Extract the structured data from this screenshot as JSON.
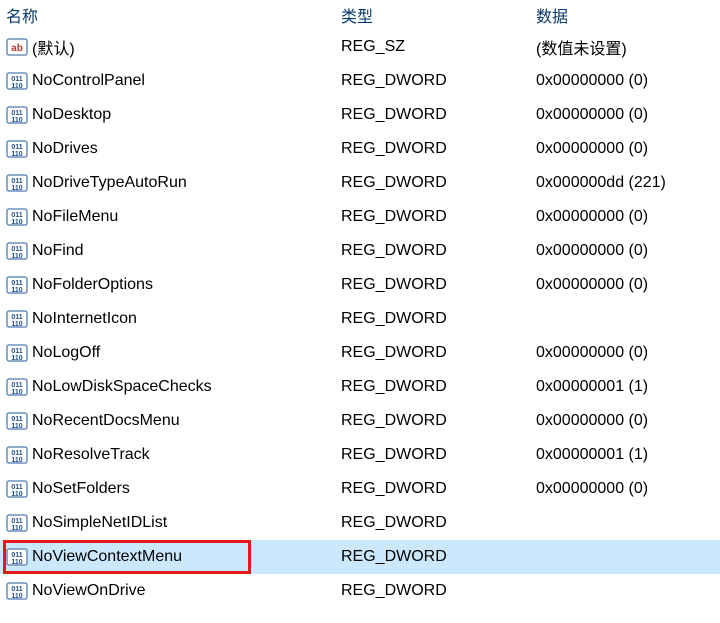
{
  "columns": {
    "name": "名称",
    "type": "类型",
    "data": "数据"
  },
  "rows": [
    {
      "icon": "string",
      "name": "(默认)",
      "type": "REG_SZ",
      "data": "(数值未设置)",
      "selected": false,
      "highlighted": false
    },
    {
      "icon": "dword",
      "name": "NoControlPanel",
      "type": "REG_DWORD",
      "data": "0x00000000 (0)",
      "selected": false,
      "highlighted": false
    },
    {
      "icon": "dword",
      "name": "NoDesktop",
      "type": "REG_DWORD",
      "data": "0x00000000 (0)",
      "selected": false,
      "highlighted": false
    },
    {
      "icon": "dword",
      "name": "NoDrives",
      "type": "REG_DWORD",
      "data": "0x00000000 (0)",
      "selected": false,
      "highlighted": false
    },
    {
      "icon": "dword",
      "name": "NoDriveTypeAutoRun",
      "type": "REG_DWORD",
      "data": "0x000000dd (221)",
      "selected": false,
      "highlighted": false
    },
    {
      "icon": "dword",
      "name": "NoFileMenu",
      "type": "REG_DWORD",
      "data": "0x00000000 (0)",
      "selected": false,
      "highlighted": false
    },
    {
      "icon": "dword",
      "name": "NoFind",
      "type": "REG_DWORD",
      "data": "0x00000000 (0)",
      "selected": false,
      "highlighted": false
    },
    {
      "icon": "dword",
      "name": "NoFolderOptions",
      "type": "REG_DWORD",
      "data": "0x00000000 (0)",
      "selected": false,
      "highlighted": false
    },
    {
      "icon": "dword",
      "name": "NoInternetIcon",
      "type": "REG_DWORD",
      "data": "",
      "selected": false,
      "highlighted": false
    },
    {
      "icon": "dword",
      "name": "NoLogOff",
      "type": "REG_DWORD",
      "data": "0x00000000 (0)",
      "selected": false,
      "highlighted": false
    },
    {
      "icon": "dword",
      "name": "NoLowDiskSpaceChecks",
      "type": "REG_DWORD",
      "data": "0x00000001 (1)",
      "selected": false,
      "highlighted": false
    },
    {
      "icon": "dword",
      "name": "NoRecentDocsMenu",
      "type": "REG_DWORD",
      "data": "0x00000000 (0)",
      "selected": false,
      "highlighted": false
    },
    {
      "icon": "dword",
      "name": "NoResolveTrack",
      "type": "REG_DWORD",
      "data": "0x00000001 (1)",
      "selected": false,
      "highlighted": false
    },
    {
      "icon": "dword",
      "name": "NoSetFolders",
      "type": "REG_DWORD",
      "data": "0x00000000 (0)",
      "selected": false,
      "highlighted": false
    },
    {
      "icon": "dword",
      "name": "NoSimpleNetIDList",
      "type": "REG_DWORD",
      "data": "",
      "selected": false,
      "highlighted": false
    },
    {
      "icon": "dword",
      "name": "NoViewContextMenu",
      "type": "REG_DWORD",
      "data": "",
      "selected": true,
      "highlighted": true
    },
    {
      "icon": "dword",
      "name": "NoViewOnDrive",
      "type": "REG_DWORD",
      "data": "",
      "selected": false,
      "highlighted": false
    }
  ]
}
